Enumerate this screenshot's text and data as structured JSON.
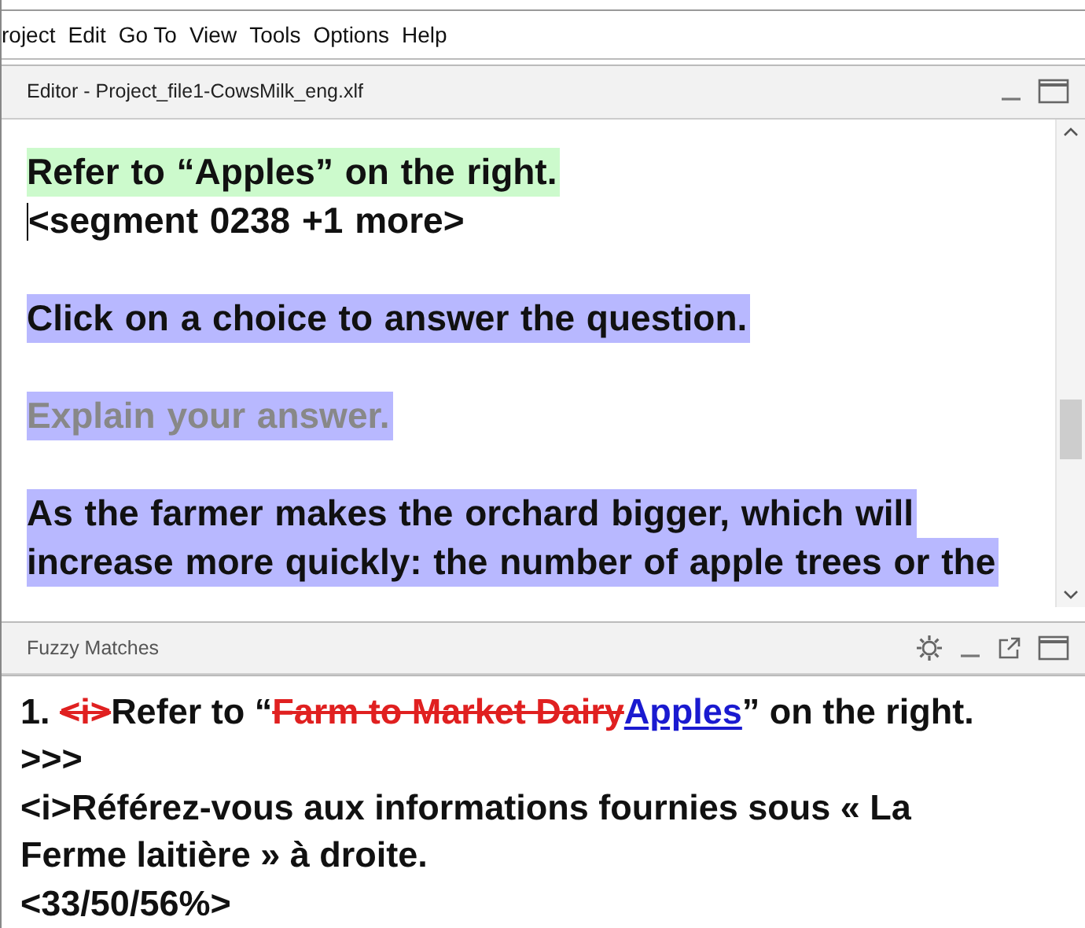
{
  "menu_bar": {
    "items": [
      "roject",
      "Edit",
      "Go To",
      "View",
      "Tools",
      "Options",
      "Help"
    ]
  },
  "editor": {
    "title": "Editor - Project_file1-CowsMilk_eng.xlf",
    "segments": [
      {
        "kind": "source",
        "disabled": false,
        "lines": [
          "Refer to “Apples” on the right."
        ]
      },
      {
        "kind": "marker",
        "disabled": false,
        "lines": [
          "<segment 0238 +1 more>"
        ]
      },
      {
        "kind": "source_other",
        "disabled": false,
        "lines": [
          "Click on a choice to answer the question."
        ]
      },
      {
        "kind": "source_other",
        "disabled": true,
        "lines": [
          "Explain your answer."
        ]
      },
      {
        "kind": "source_other",
        "disabled": false,
        "lines": [
          "As the farmer makes the orchard bigger, which will",
          "increase more quickly: the number of apple trees or the"
        ]
      }
    ]
  },
  "fuzzy_matches": {
    "title": "Fuzzy Matches",
    "match_line": [
      {
        "kind": "plain",
        "text": "1. "
      },
      {
        "kind": "deleted",
        "text": "<i>"
      },
      {
        "kind": "plain",
        "text": "Refer to “"
      },
      {
        "kind": "deleted",
        "text": "Farm to Market Dairy"
      },
      {
        "kind": "inserted",
        "text": "Apples"
      },
      {
        "kind": "plain",
        "text": "” on the right."
      }
    ],
    "lines": [
      ">>>",
      "<i>Référez-vous aux informations fournies sous « La",
      "Ferme laitière » à droite.",
      "<33/50/56%>"
    ]
  }
}
